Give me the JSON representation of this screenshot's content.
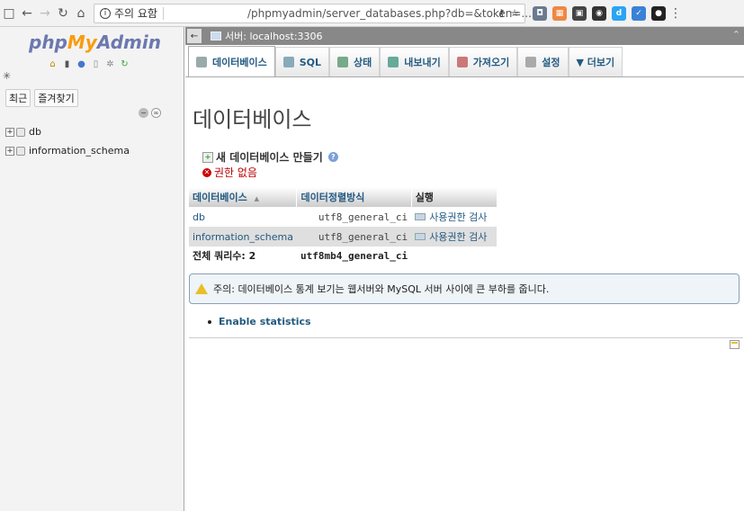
{
  "browser": {
    "security_label": "주의 요함",
    "url": "/phpmyadmin/server_databases.php?db=&token=...",
    "extensions": [
      {
        "name": "ext-shield",
        "color": "#6b7a8f",
        "glyph": "◘"
      },
      {
        "name": "ext-multi",
        "color": "#e84",
        "glyph": "▦"
      },
      {
        "name": "ext-dark",
        "color": "#444",
        "glyph": "▣"
      },
      {
        "name": "ext-ghost",
        "color": "#333",
        "glyph": "◉"
      },
      {
        "name": "ext-d",
        "color": "#2aa4f4",
        "glyph": "d"
      },
      {
        "name": "ext-check",
        "color": "#3b82d6",
        "glyph": "✓"
      },
      {
        "name": "ext-profile",
        "color": "#222",
        "glyph": "●"
      }
    ]
  },
  "nav": {
    "logo_php": "php",
    "logo_my": "My",
    "logo_admin": "Admin",
    "recent_tab": "최근",
    "favorites_tab": "즐겨찾기",
    "tree": [
      {
        "name": "db"
      },
      {
        "name": "information_schema"
      }
    ]
  },
  "server_bar": {
    "label": "서버: localhost:3306"
  },
  "tabs": [
    {
      "label": "데이터베이스",
      "icon_color": "#9aa",
      "active": true
    },
    {
      "label": "SQL",
      "icon_color": "#8ab",
      "active": false
    },
    {
      "label": "상태",
      "icon_color": "#7a8",
      "active": false
    },
    {
      "label": "내보내기",
      "icon_color": "#6a9",
      "active": false
    },
    {
      "label": "가져오기",
      "icon_color": "#c77",
      "active": false
    },
    {
      "label": "설정",
      "icon_color": "#aaa",
      "active": false
    },
    {
      "label": "▼ 더보기",
      "icon_color": "",
      "active": false
    }
  ],
  "main": {
    "title": "데이터베이스",
    "create_db": "새 데이터베이스 만들기",
    "no_privileges": "권한 없음",
    "table": {
      "headers": {
        "database": "데이터베이스",
        "sort_indicator": "▲",
        "collation": "데이터정렬방식",
        "action": "실행"
      },
      "rows": [
        {
          "name": "db",
          "collation": "utf8_general_ci",
          "action": "사용권한 검사"
        },
        {
          "name": "information_schema",
          "collation": "utf8_general_ci",
          "action": "사용권한 검사"
        }
      ],
      "total_label": "전체 쿼리수: 2",
      "total_collation": "utf8mb4_general_ci"
    },
    "notice": "주의: 데이터베이스 통계 보기는 웹서버와 MySQL 서버 사이에 큰 부하를 줍니다.",
    "enable_stats": "Enable statistics"
  }
}
